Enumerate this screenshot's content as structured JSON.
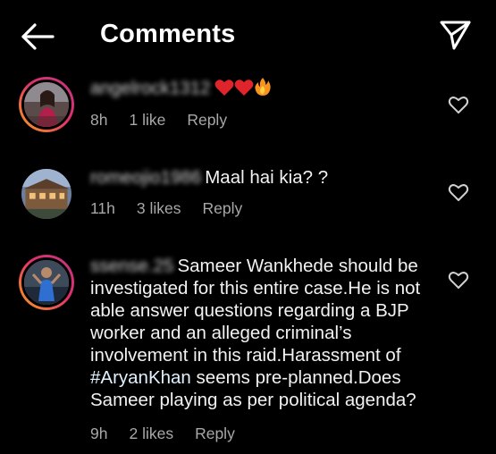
{
  "header": {
    "title": "Comments",
    "back_icon": "arrow-left-icon",
    "share_icon": "paper-plane-icon"
  },
  "comments": [
    {
      "username": "angelrock1312",
      "text": "",
      "emojis": [
        "red-heart-icon",
        "red-heart-icon",
        "fire-icon"
      ],
      "time": "8h",
      "likes": "1 like",
      "reply": "Reply"
    },
    {
      "username": "romeojio1986",
      "text": "Maal hai kia? ?",
      "time": "11h",
      "likes": "3 likes",
      "reply": "Reply"
    },
    {
      "username": "ssense.25",
      "text_before_hashtag": "Sameer Wankhede should be investigated for this entire case.He is not able answer questions regarding a BJP worker and an alleged criminal’s involvement in this raid.Harassment of ",
      "hashtag": "#AryanKhan",
      "text_after_hashtag": " seems pre-planned.Does Sameer playing as per political agenda?",
      "time": "9h",
      "likes": "2 likes",
      "reply": "Reply"
    }
  ],
  "colors": {
    "background": "#000000",
    "text": "#ffffff",
    "meta": "#a8a8a8",
    "heart_emoji": "#e0242b",
    "story_ring_start": "#f9a11b",
    "story_ring_end": "#c13584"
  }
}
